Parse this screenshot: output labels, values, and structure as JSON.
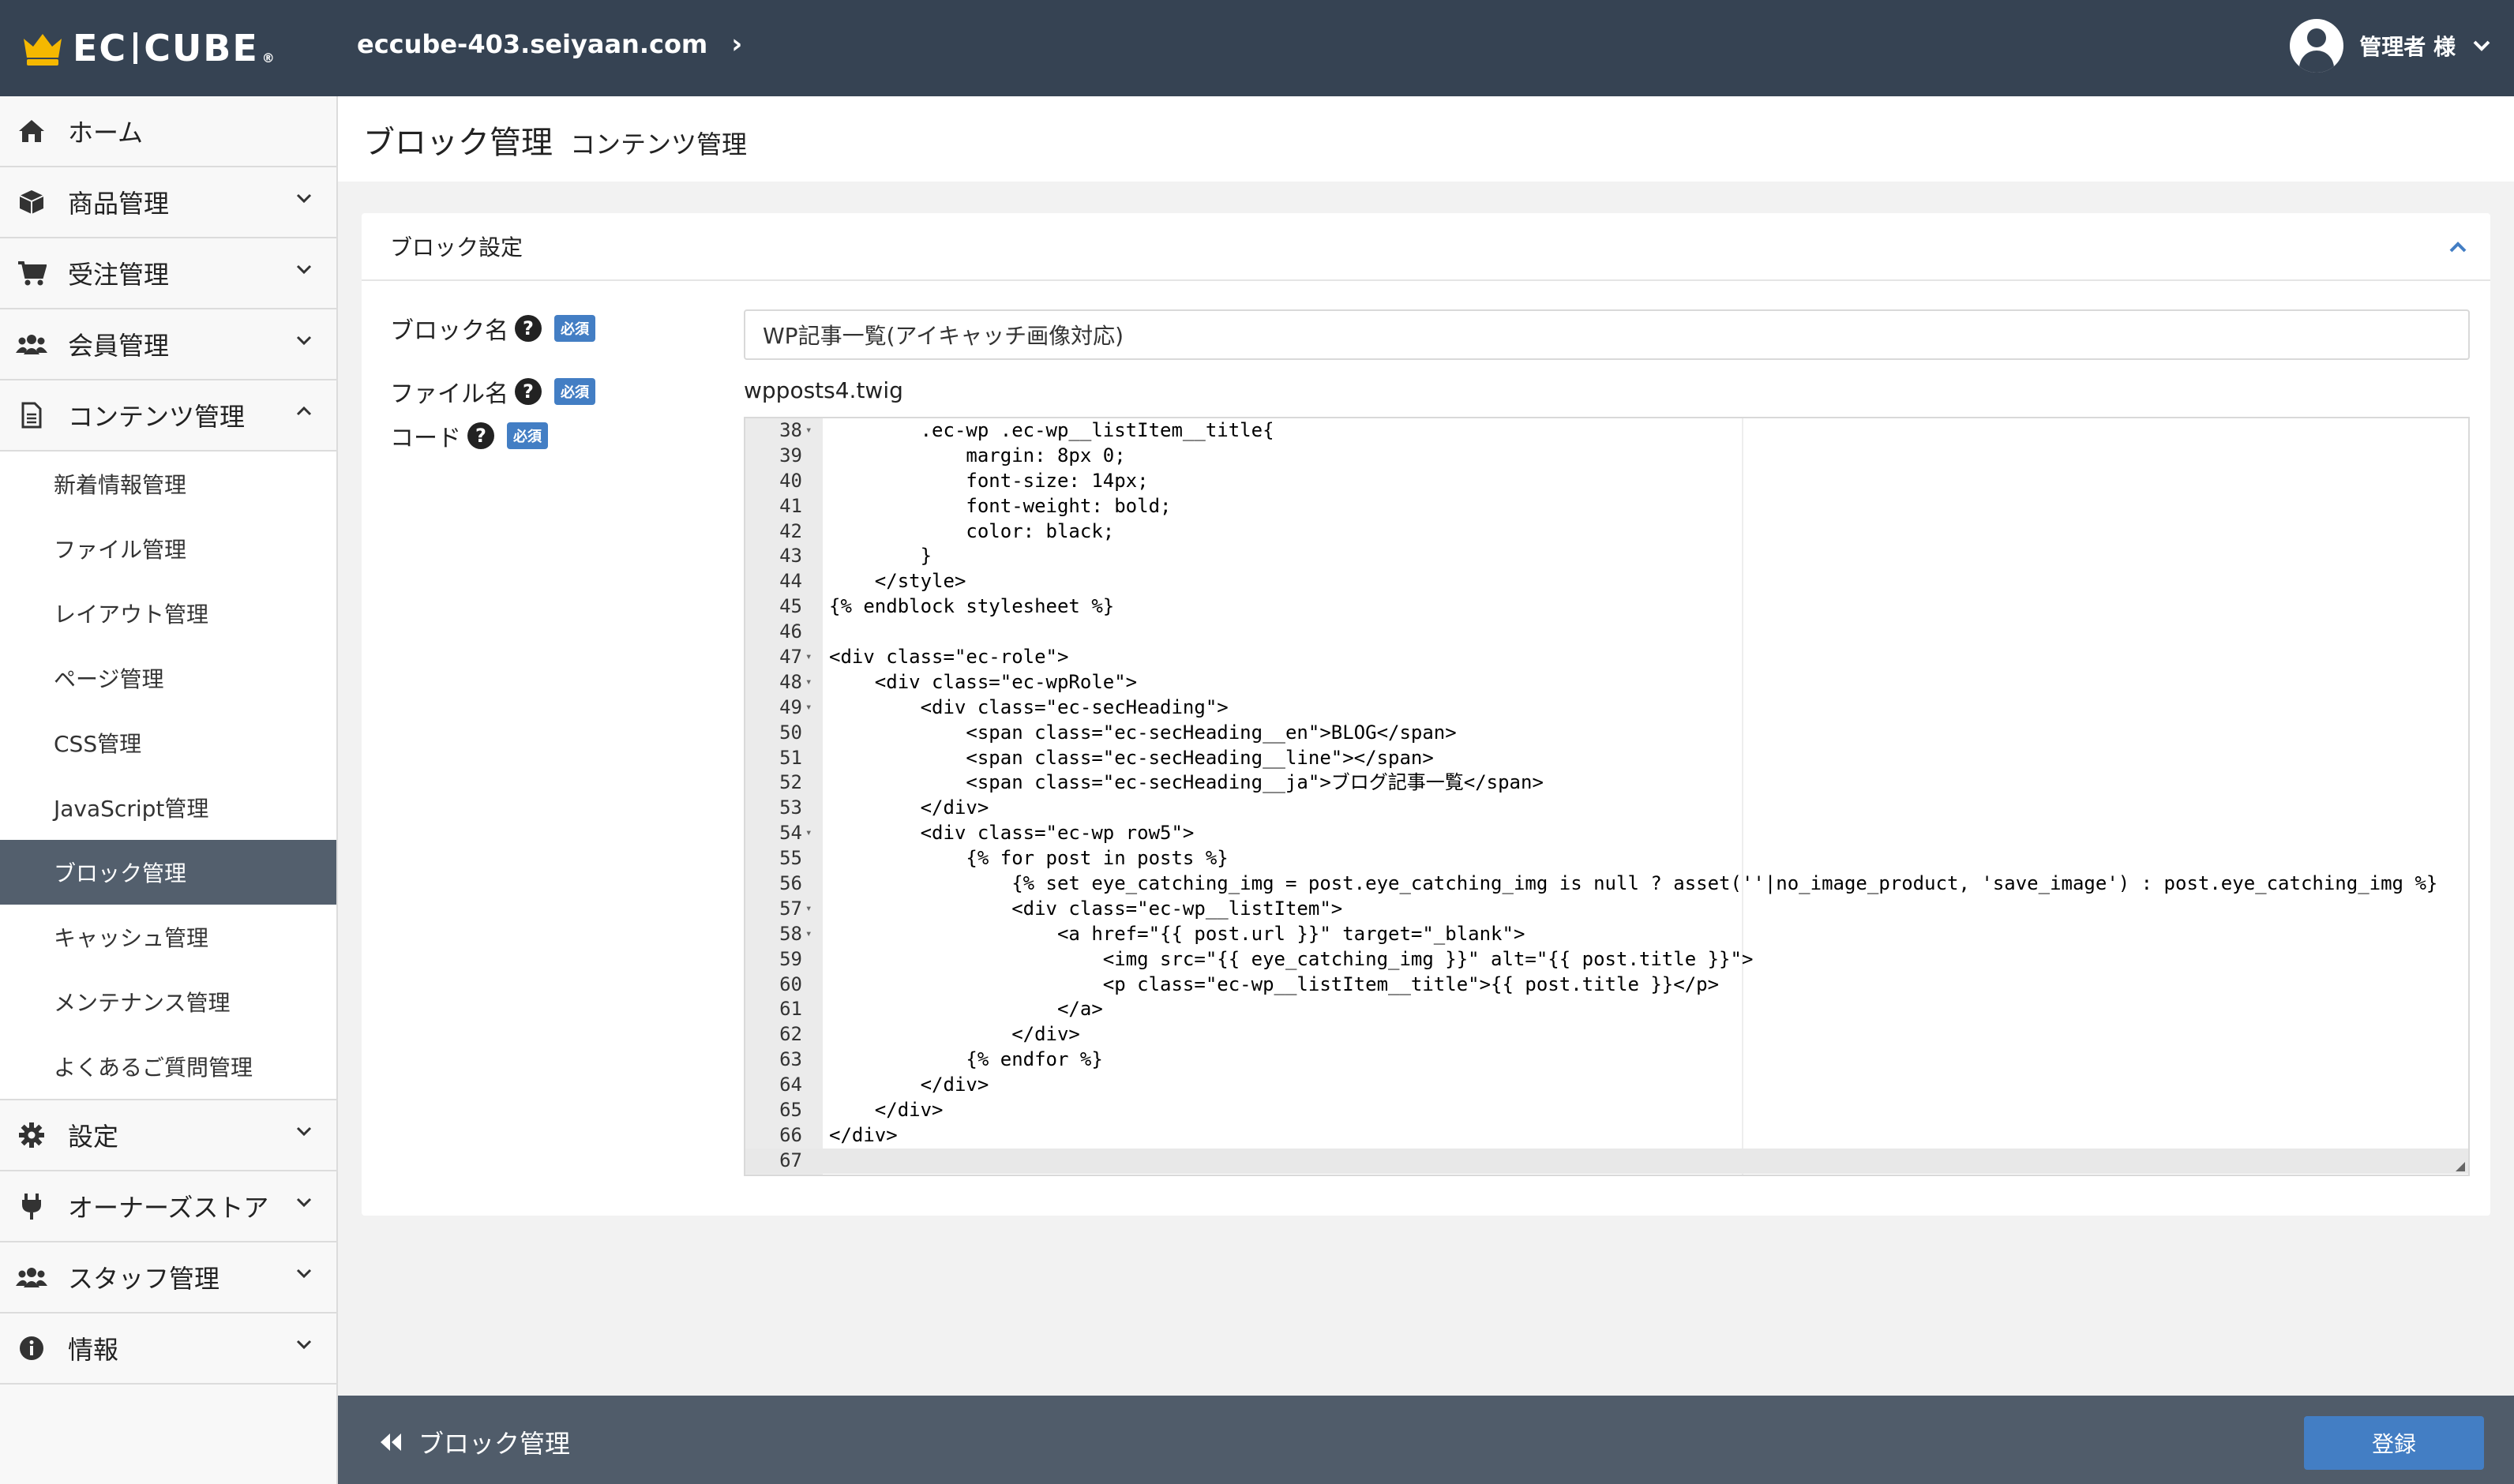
{
  "header": {
    "logo_text_left": "EC",
    "logo_text_right": "CUBE",
    "logo_reg": "®",
    "site": "eccube-403.seiyaan.com",
    "user": "管理者 様"
  },
  "sidebar": {
    "items": [
      {
        "label": "ホーム",
        "icon": "home-icon"
      },
      {
        "label": "商品管理",
        "icon": "box-icon"
      },
      {
        "label": "受注管理",
        "icon": "cart-icon"
      },
      {
        "label": "会員管理",
        "icon": "users-icon"
      },
      {
        "label": "コンテンツ管理",
        "icon": "file-icon"
      },
      {
        "label": "設定",
        "icon": "gear-icon"
      },
      {
        "label": "オーナーズストア",
        "icon": "plug-icon"
      },
      {
        "label": "スタッフ管理",
        "icon": "staff-icon"
      },
      {
        "label": "情報",
        "icon": "info-icon"
      }
    ],
    "content_sub": [
      "新着情報管理",
      "ファイル管理",
      "レイアウト管理",
      "ページ管理",
      "CSS管理",
      "JavaScript管理",
      "ブロック管理",
      "キャッシュ管理",
      "メンテナンス管理",
      "よくあるご質問管理"
    ]
  },
  "page": {
    "title": "ブロック管理",
    "subtitle": "コンテンツ管理"
  },
  "card": {
    "title": "ブロック設定",
    "block_name_label": "ブロック名",
    "file_name_label": "ファイル名",
    "code_label": "コード",
    "required": "必須",
    "help": "?",
    "block_name_value": "WP記事一覧(アイキャッチ画像対応)",
    "file_name_value": "wpposts4.twig"
  },
  "colors": {
    "header_bg": "#364353",
    "accent": "#437ec4",
    "sidebar_active": "#535f6d",
    "footer_bg": "#505c6a"
  },
  "code": {
    "lines": [
      {
        "n": "38",
        "fold": true,
        "text": "        .ec-wp .ec-wp__listItem__title{"
      },
      {
        "n": "39",
        "fold": false,
        "text": "            margin: 8px 0;"
      },
      {
        "n": "40",
        "fold": false,
        "text": "            font-size: 14px;"
      },
      {
        "n": "41",
        "fold": false,
        "text": "            font-weight: bold;"
      },
      {
        "n": "42",
        "fold": false,
        "text": "            color: black;"
      },
      {
        "n": "43",
        "fold": false,
        "text": "        }"
      },
      {
        "n": "44",
        "fold": false,
        "text": "    </style>"
      },
      {
        "n": "45",
        "fold": false,
        "text": "{% endblock stylesheet %}"
      },
      {
        "n": "46",
        "fold": false,
        "text": ""
      },
      {
        "n": "47",
        "fold": true,
        "text": "<div class=\"ec-role\">"
      },
      {
        "n": "48",
        "fold": true,
        "text": "    <div class=\"ec-wpRole\">"
      },
      {
        "n": "49",
        "fold": true,
        "text": "        <div class=\"ec-secHeading\">"
      },
      {
        "n": "50",
        "fold": false,
        "text": "            <span class=\"ec-secHeading__en\">BLOG</span>"
      },
      {
        "n": "51",
        "fold": false,
        "text": "            <span class=\"ec-secHeading__line\"></span>"
      },
      {
        "n": "52",
        "fold": false,
        "text": "            <span class=\"ec-secHeading__ja\">ブログ記事一覧</span>"
      },
      {
        "n": "53",
        "fold": false,
        "text": "        </div>"
      },
      {
        "n": "54",
        "fold": true,
        "text": "        <div class=\"ec-wp row5\">"
      },
      {
        "n": "55",
        "fold": false,
        "text": "            {% for post in posts %}"
      },
      {
        "n": "56",
        "fold": false,
        "text": "                {% set eye_catching_img = post.eye_catching_img is null ? asset(''|no_image_product, 'save_image') : post.eye_catching_img %}"
      },
      {
        "n": "57",
        "fold": true,
        "text": "                <div class=\"ec-wp__listItem\">"
      },
      {
        "n": "58",
        "fold": true,
        "text": "                    <a href=\"{{ post.url }}\" target=\"_blank\">"
      },
      {
        "n": "59",
        "fold": false,
        "text": "                        <img src=\"{{ eye_catching_img }}\" alt=\"{{ post.title }}\">"
      },
      {
        "n": "60",
        "fold": false,
        "text": "                        <p class=\"ec-wp__listItem__title\">{{ post.title }}</p>"
      },
      {
        "n": "61",
        "fold": false,
        "text": "                    </a>"
      },
      {
        "n": "62",
        "fold": false,
        "text": "                </div>"
      },
      {
        "n": "63",
        "fold": false,
        "text": "            {% endfor %}"
      },
      {
        "n": "64",
        "fold": false,
        "text": "        </div>"
      },
      {
        "n": "65",
        "fold": false,
        "text": "    </div>"
      },
      {
        "n": "66",
        "fold": false,
        "text": "</div>"
      },
      {
        "n": "67",
        "fold": false,
        "text": ""
      }
    ]
  },
  "footer": {
    "back_label": "ブロック管理",
    "submit_label": "登録"
  }
}
